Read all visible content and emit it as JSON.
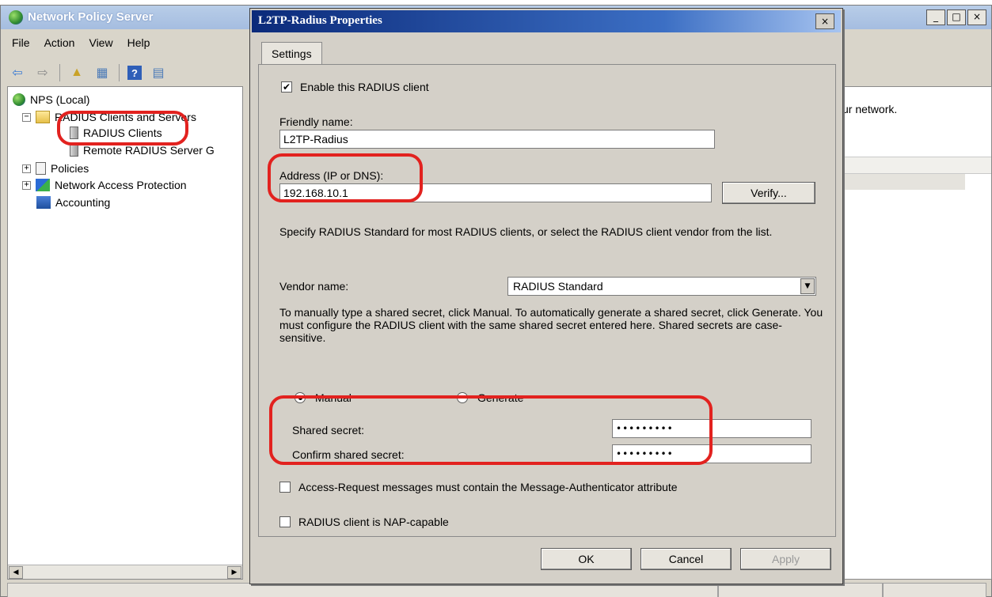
{
  "main_window": {
    "title": "Network Policy Server",
    "controls": {
      "minimize": "_",
      "maximize": "□",
      "close": "×"
    },
    "menu": [
      "File",
      "Action",
      "View",
      "Help"
    ],
    "tree": {
      "root": "NPS (Local)",
      "radius_clients_and_servers": "RADIUS Clients and Servers",
      "radius_clients": "RADIUS Clients",
      "remote_radius_server_groups": "Remote RADIUS Server G",
      "policies": "Policies",
      "nap": "Network Access Protection",
      "accounting": "Accounting"
    },
    "right_pane_text": "ur network."
  },
  "dialog": {
    "title": "L2TP-Radius Properties",
    "close": "×",
    "tab": "Settings",
    "enable_client": {
      "label": "Enable this RADIUS client",
      "checked": true
    },
    "friendly_name": {
      "label": "Friendly name:",
      "value": "L2TP-Radius"
    },
    "address": {
      "label": "Address (IP or DNS):",
      "value": "192.168.10.1",
      "verify": "Verify..."
    },
    "vendor_instructions": "Specify RADIUS Standard for most RADIUS clients, or select the RADIUS client vendor from the list.",
    "vendor": {
      "label": "Vendor name:",
      "value": "RADIUS Standard"
    },
    "secret_instructions": "To manually type a shared secret, click Manual. To automatically generate a shared secret, click Generate. You must configure the RADIUS client with the same shared secret entered here. Shared secrets are case-sensitive.",
    "secret_mode": {
      "manual": "Manual",
      "generate": "Generate",
      "selected": "Manual"
    },
    "shared_secret": {
      "label": "Shared secret:",
      "value": "•••••••••"
    },
    "confirm_secret": {
      "label": "Confirm shared secret:",
      "value": "•••••••••"
    },
    "message_authenticator": {
      "label": "Access-Request messages must contain the Message-Authenticator attribute",
      "checked": false
    },
    "nap_capable": {
      "label": "RADIUS client is NAP-capable",
      "checked": false
    },
    "buttons": {
      "ok": "OK",
      "cancel": "Cancel",
      "apply": "Apply"
    }
  }
}
